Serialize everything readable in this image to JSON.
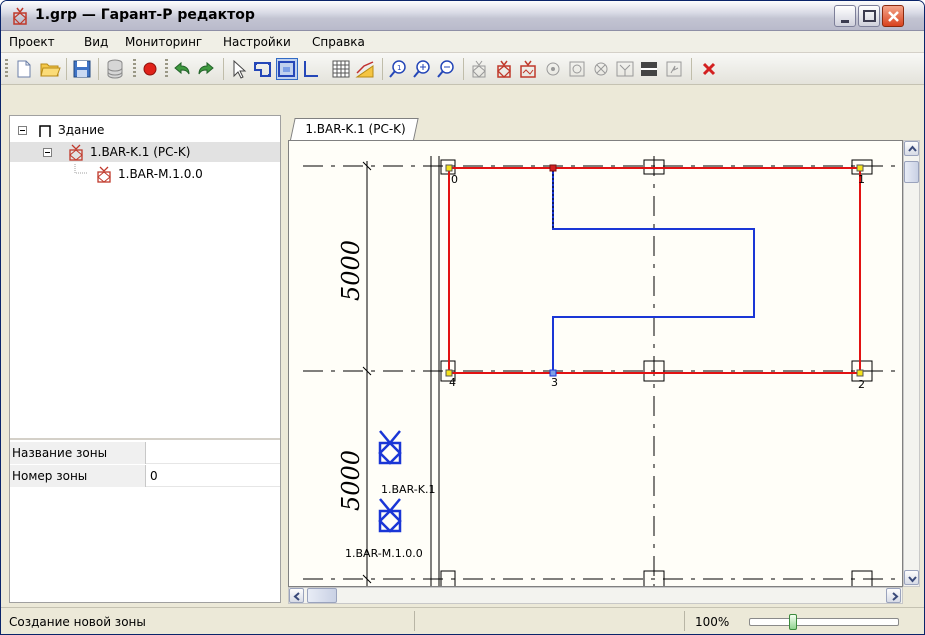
{
  "window": {
    "title": "1.grp — Гарант-Р редактор"
  },
  "menu": {
    "items": [
      "Проект",
      "Вид",
      "Мониторинг",
      "Настройки",
      "Справка"
    ]
  },
  "tree": {
    "root_label": "Здание",
    "child_label": "1.BAR-K.1 (PC-K)",
    "grandchild_label": "1.BAR-M.1.0.0"
  },
  "properties": {
    "rows": [
      {
        "key": "Название зоны",
        "value": ""
      },
      {
        "key": "Номер зоны",
        "value": "0"
      }
    ]
  },
  "tab": {
    "label": "1.BAR-K.1 (PC-K)"
  },
  "canvas": {
    "dimension_top": "5000",
    "dimension_bottom": "5000",
    "vertex_labels": [
      "0",
      "1",
      "2",
      "3",
      "4"
    ],
    "device_labels": [
      "1.BAR-K.1",
      "1.BAR-M.1.0.0"
    ],
    "colors": {
      "zone": "#e21212",
      "route": "#1a36d6",
      "device": "#1a36d6",
      "grid": "#000000"
    }
  },
  "status": {
    "text": "Создание новой зоны",
    "zoom": "100%",
    "zoom_slider_fraction": 0.28
  }
}
